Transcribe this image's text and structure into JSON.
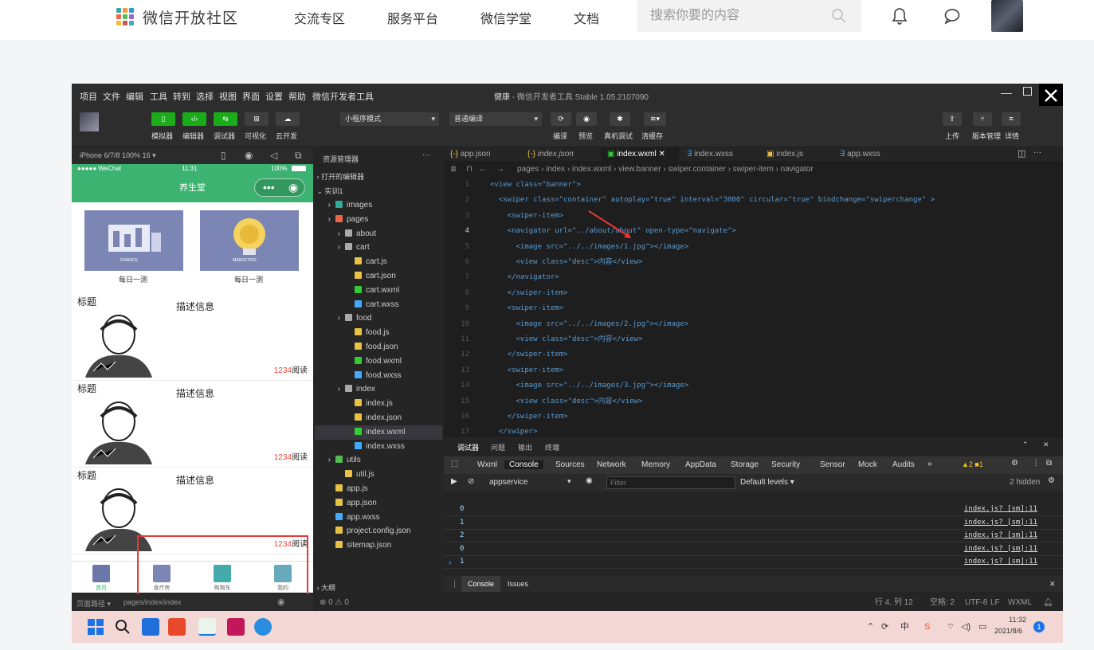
{
  "site": {
    "brand": "微信开放社区",
    "nav": [
      "交流专区",
      "服务平台",
      "微信学堂",
      "文档"
    ],
    "search_placeholder": "搜索你要的内容"
  },
  "ide": {
    "menu": [
      "项目",
      "文件",
      "编辑",
      "工具",
      "转到",
      "选择",
      "视图",
      "界面",
      "设置",
      "帮助",
      "微信开发者工具"
    ],
    "title_app": "健康",
    "title_rest": "- 微信开发者工具 Stable 1.05.2107090",
    "toolbar": {
      "left_labels": [
        "模拟器",
        "编辑器",
        "调试器",
        "可视化",
        "云开发"
      ],
      "mode": "小程序模式",
      "compile": "普通编译",
      "mid_labels": [
        "编译",
        "预览",
        "真机调试",
        "清缓存"
      ],
      "right_labels": [
        "上传",
        "版本管理",
        "详情"
      ]
    },
    "sim": {
      "device": "iPhone 6/7/8 100% 16 ▾",
      "carrier": "●●●●● WeChat",
      "time": "11:31",
      "battery": "100%",
      "page_title": "养生堂",
      "tiles": [
        {
          "label": "每日一测",
          "caption": "FINANCE"
        },
        {
          "label": "每日一测",
          "caption": "MARKETING"
        }
      ],
      "news": [
        {
          "title": "标题",
          "desc": "描述信息",
          "count": "1234",
          "suffix": "阅读"
        },
        {
          "title": "标题",
          "desc": "描述信息",
          "count": "1234",
          "suffix": "阅读"
        },
        {
          "title": "标题",
          "desc": "描述信息",
          "count": "1234",
          "suffix": "阅读"
        }
      ],
      "tabs": [
        "首页",
        "食疗房",
        "购物车",
        "我的"
      ],
      "footer_path": "页面路径 ▾",
      "footer_page": "pages/index/index"
    },
    "explorer": {
      "title": "资源管理器",
      "open_editors": "打开的编辑器",
      "project": "实训1",
      "outline": "大纲",
      "errors": "⊗ 0 ⚠ 0",
      "items": [
        {
          "name": "images",
          "depth": 1,
          "kind": "folder-img"
        },
        {
          "name": "pages",
          "depth": 1,
          "kind": "folder-red"
        },
        {
          "name": "about",
          "depth": 2,
          "kind": "folder"
        },
        {
          "name": "cart",
          "depth": 2,
          "kind": "folder"
        },
        {
          "name": "cart.js",
          "depth": 3,
          "kind": "js"
        },
        {
          "name": "cart.json",
          "depth": 3,
          "kind": "json"
        },
        {
          "name": "cart.wxml",
          "depth": 3,
          "kind": "wxml"
        },
        {
          "name": "cart.wxss",
          "depth": 3,
          "kind": "wxss"
        },
        {
          "name": "food",
          "depth": 2,
          "kind": "folder"
        },
        {
          "name": "food.js",
          "depth": 3,
          "kind": "js"
        },
        {
          "name": "food.json",
          "depth": 3,
          "kind": "json"
        },
        {
          "name": "food.wxml",
          "depth": 3,
          "kind": "wxml"
        },
        {
          "name": "food.wxss",
          "depth": 3,
          "kind": "wxss"
        },
        {
          "name": "index",
          "depth": 2,
          "kind": "folder"
        },
        {
          "name": "index.js",
          "depth": 3,
          "kind": "js"
        },
        {
          "name": "index.json",
          "depth": 3,
          "kind": "json"
        },
        {
          "name": "index.wxml",
          "depth": 3,
          "kind": "wxml",
          "selected": true
        },
        {
          "name": "index.wxss",
          "depth": 3,
          "kind": "wxss"
        },
        {
          "name": "utils",
          "depth": 1,
          "kind": "folder-green"
        },
        {
          "name": "util.js",
          "depth": 2,
          "kind": "js"
        },
        {
          "name": "app.js",
          "depth": 1,
          "kind": "js"
        },
        {
          "name": "app.json",
          "depth": 1,
          "kind": "json"
        },
        {
          "name": "app.wxss",
          "depth": 1,
          "kind": "wxss"
        },
        {
          "name": "project.config.json",
          "depth": 1,
          "kind": "json"
        },
        {
          "name": "sitemap.json",
          "depth": 1,
          "kind": "json"
        }
      ]
    },
    "editor": {
      "tabs": [
        "app.json",
        "index.json",
        "index.wxml",
        "index.wxss",
        "index.js",
        "app.wxss"
      ],
      "active_tab": "index.wxml",
      "breadcrumb": "pages › index › index.wxml › view.banner › swiper.container › swiper-item › navigator",
      "lines": [
        "<view class=\"banner\">",
        "  <swiper class=\"container\" autoplay=\"true\" interval=\"3000\" circular=\"true\" bindchange=\"swiperchange\" >",
        "    <swiper-item>",
        "    <navigator url=\"../about/about\" open-type=\"navigate\">",
        "      <image src=\"../../images/1.jpg\"></image>",
        "      <view class=\"desc\">内容</view>",
        "    </navigator>",
        "    </swiper-item>",
        "    <swiper-item>",
        "      <image src=\"../../images/2.jpg\"></image>",
        "      <view class=\"desc\">内容</view>",
        "    </swiper-item>",
        "    <swiper-item>",
        "      <image src=\"../../images/3.jpg\"></image>",
        "      <view class=\"desc\">内容</view>",
        "    </swiper-item>",
        "  </swiper>"
      ]
    },
    "devtools": {
      "tabs": [
        "调试器",
        "问题",
        "输出",
        "终端"
      ],
      "panels": [
        "Wxml",
        "Console",
        "Sources",
        "Network",
        "Memory",
        "AppData",
        "Storage",
        "Security",
        "Sensor",
        "Mock",
        "Audits"
      ],
      "active_panel": "Console",
      "warnings": "▲2 ■1",
      "context": "appservice",
      "filter_placeholder": "Filter",
      "levels": "Default levels ▾",
      "hidden": "2 hidden",
      "rows": [
        {
          "v": "0",
          "src": "index.js? [sm]:11"
        },
        {
          "v": "1",
          "src": "index.js? [sm]:11"
        },
        {
          "v": "2",
          "src": "index.js? [sm]:11"
        },
        {
          "v": "0",
          "src": "index.js? [sm]:11"
        },
        {
          "v": "1",
          "src": "index.js? [sm]:11"
        }
      ],
      "footer_tabs": [
        "Console",
        "Issues"
      ]
    },
    "status": {
      "pos": "行 4, 列 12",
      "indent": "空格: 2",
      "enc": "UTF-8",
      "eol": "LF",
      "lang": "WXML"
    }
  },
  "taskbar": {
    "time": "11:32",
    "date": "2021/8/6",
    "badge": "1",
    "ime": "中"
  }
}
